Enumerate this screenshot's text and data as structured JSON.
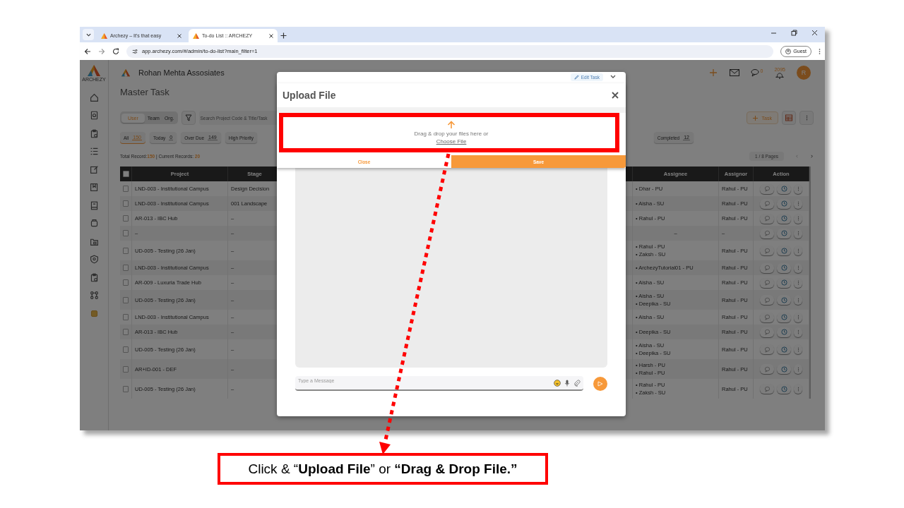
{
  "browser": {
    "tabs": [
      {
        "title": "Archezy – It's that easy",
        "selected": false
      },
      {
        "title": "To-do List :: ARCHEZY",
        "selected": true
      }
    ],
    "url": "app.archezy.com/#/admin/to-do-list?main_filter=1",
    "profile": "Guest"
  },
  "app": {
    "logo_caption": "ARCHEZY",
    "company": "Rohan Mehta Assosiates",
    "messages_count": "0",
    "notifications_count": "2095",
    "avatar": "R",
    "page_title": "Master Task",
    "scope_tabs": [
      {
        "label": "User",
        "selected": true
      },
      {
        "label": "Team",
        "selected": false
      },
      {
        "label": "Org.",
        "selected": false
      }
    ],
    "search": {
      "placeholder": "Search Project Code & Title/Task"
    },
    "add_button": "Task",
    "filters": [
      {
        "label": "All",
        "count": "150",
        "selected": true
      },
      {
        "label": "Today",
        "count": "0",
        "selected": false
      },
      {
        "label": "Over Due",
        "count": "149",
        "selected": false
      },
      {
        "label": "High Priority",
        "selected": false
      }
    ],
    "filters_right": [
      {
        "label": "Completed",
        "count": "12",
        "selected": false
      }
    ],
    "summary": {
      "total_label": "Total Record:",
      "total": "150",
      "current_label": " | Current Records: ",
      "current": "20"
    },
    "pagination": "1 / 8 Pages",
    "table": {
      "columns": [
        "Project",
        "Stage",
        "Assignee",
        "Assignor",
        "Action"
      ],
      "select_all_checked": false,
      "rows": [
        {
          "checked": false,
          "project": "LND-003 - Institutional Campus",
          "stage": "Design Decision",
          "assignees": [
            "• Dhar - PU"
          ],
          "assignor": "Rahul - PU"
        },
        {
          "checked": false,
          "project": "LND-003 - Institutional Campus",
          "stage": "001 Landscape",
          "assignees": [
            "• Aisha - SU"
          ],
          "assignor": "Rahul - PU"
        },
        {
          "checked": false,
          "project": "AR-013 - IBC Hub",
          "stage": "–",
          "assignees": [
            "• Rahul - PU"
          ],
          "assignor": "Rahul - PU"
        },
        {
          "checked": false,
          "project": "–",
          "stage": "–",
          "assignee_none": "–",
          "assignor": "–"
        },
        {
          "checked": false,
          "project": "UD-005 - Testing (26 Jan)",
          "stage": "–",
          "assignees": [
            "• Rahul - PU",
            "• Zaksh - SU"
          ],
          "assignor": "Rahul - PU"
        },
        {
          "checked": false,
          "project": "LND-003 - Institutional Campus",
          "stage": "–",
          "assignees": [
            "• ArchezyTutorial01 - PU"
          ],
          "assignor": "Rahul - PU"
        },
        {
          "checked": false,
          "project": "AR-009 - Luxuria Trade Hub",
          "stage": "–",
          "assignees": [
            "• Aisha - SU"
          ],
          "assignor": "Rahul - PU"
        },
        {
          "checked": false,
          "project": "UD-005 - Testing (26 Jan)",
          "stage": "–",
          "assignees": [
            "• Aisha - SU",
            "• Deepika - SU"
          ],
          "assignor": "Rahul - PU"
        },
        {
          "checked": false,
          "project": "LND-003 - Institutional Campus",
          "stage": "–",
          "assignees": [
            "• Aisha - SU"
          ],
          "assignor": "Rahul - PU"
        },
        {
          "checked": false,
          "project": "AR-013 - IBC Hub",
          "stage": "–",
          "assignees": [
            "• Deepika - SU"
          ],
          "assignor": "Rahul - PU"
        },
        {
          "checked": false,
          "project": "UD-005 - Testing (26 Jan)",
          "stage": "–",
          "assignees": [
            "• Aisha - SU",
            "• Deepika - SU"
          ],
          "assignor": "Rahul - PU"
        },
        {
          "checked": false,
          "project": "AR+ID-001 - DEF",
          "stage": "–",
          "assignees": [
            "• Harsh - PU",
            "• Rahul - PU"
          ],
          "assignor": "Rahul - PU"
        },
        {
          "checked": false,
          "project": "UD-005 - Testing (26 Jan)",
          "stage": "–",
          "assignees": [
            "• Rahul - PU",
            "• Zaksh - SU"
          ],
          "assignor": "Rahul - PU"
        }
      ]
    }
  },
  "modal": {
    "edit_task": "Edit Task",
    "upload": {
      "title": "Upload File",
      "prompt": "Drag & drop your files here or",
      "link": "Choose File",
      "buttons": [
        {
          "label": "Close",
          "kind": "secondary"
        },
        {
          "label": "Save",
          "kind": "primary"
        }
      ]
    },
    "message": {
      "placeholder": "Type a Message"
    }
  },
  "callout": "Click & “**Upload File**” or **“Drag & Drop File.”**"
}
